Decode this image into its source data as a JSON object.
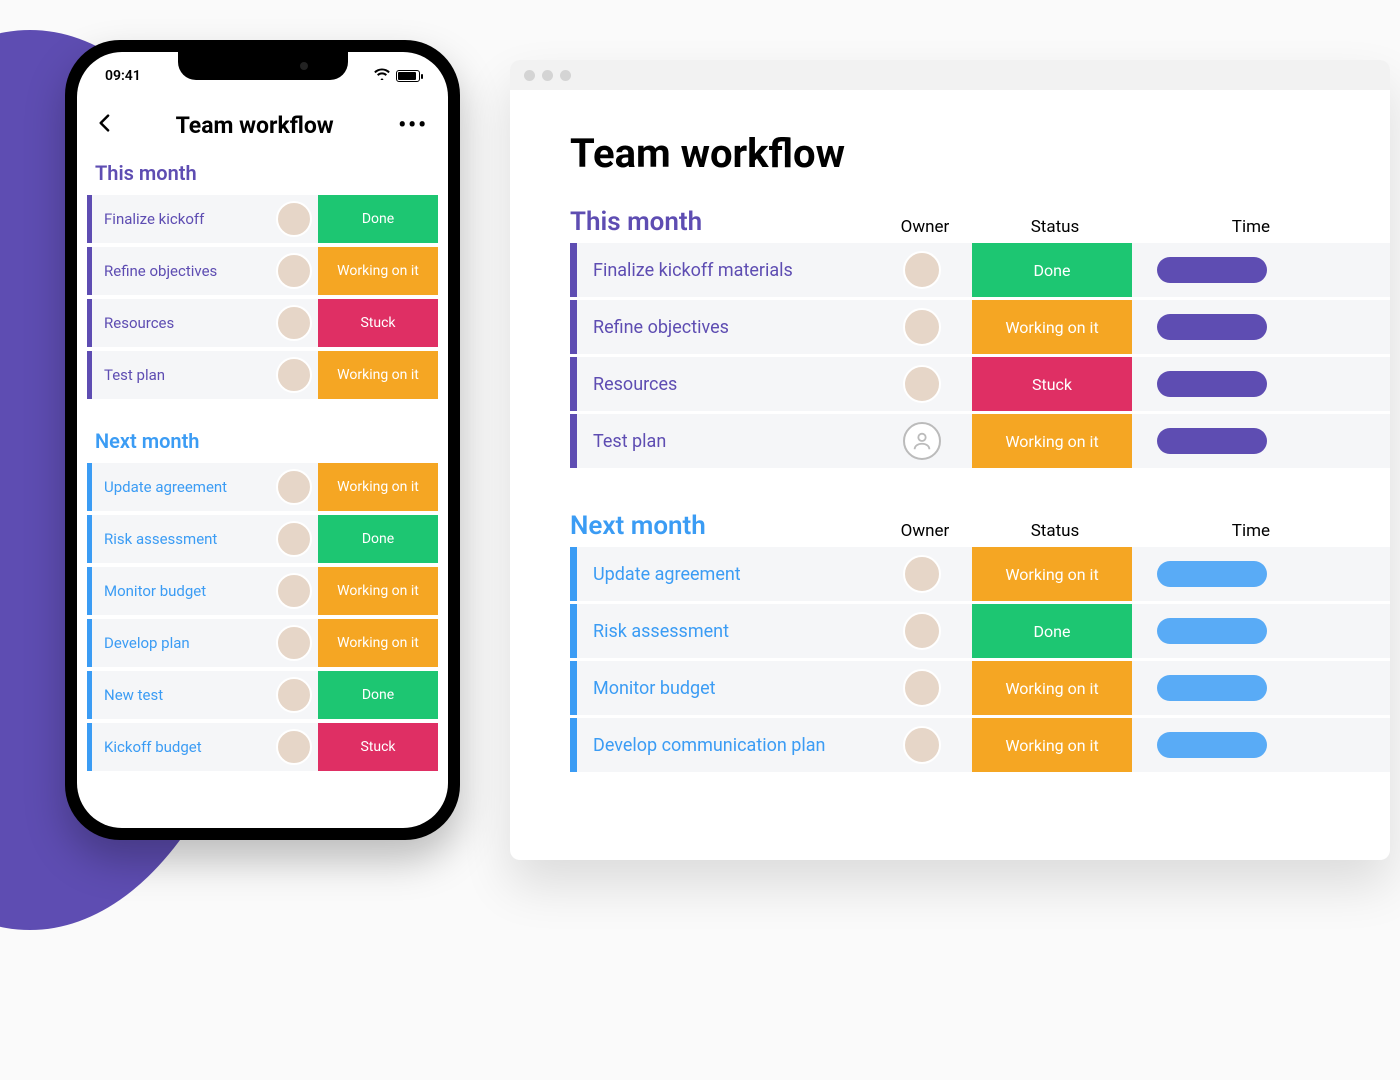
{
  "phone": {
    "clock": "09:41",
    "title": "Team workflow",
    "groups": [
      {
        "id": "this",
        "title": "This month",
        "color": "purple",
        "tasks": [
          {
            "name": "Finalize kickoff",
            "status": "Done",
            "statusClass": "st-done"
          },
          {
            "name": "Refine objectives",
            "status": "Working on it",
            "statusClass": "st-working"
          },
          {
            "name": "Resources",
            "status": "Stuck",
            "statusClass": "st-stuck"
          },
          {
            "name": "Test plan",
            "status": "Working on it",
            "statusClass": "st-working"
          }
        ]
      },
      {
        "id": "next",
        "title": "Next month",
        "color": "blue",
        "tasks": [
          {
            "name": "Update agreement",
            "status": "Working on it",
            "statusClass": "st-working"
          },
          {
            "name": "Risk assessment",
            "status": "Done",
            "statusClass": "st-done"
          },
          {
            "name": "Monitor budget",
            "status": "Working on it",
            "statusClass": "st-working"
          },
          {
            "name": "Develop plan",
            "status": "Working on it",
            "statusClass": "st-working"
          },
          {
            "name": "New test",
            "status": "Done",
            "statusClass": "st-done"
          },
          {
            "name": "Kickoff budget",
            "status": "Stuck",
            "statusClass": "st-stuck"
          }
        ]
      }
    ]
  },
  "desktop": {
    "title": "Team workflow",
    "columns": {
      "owner": "Owner",
      "status": "Status",
      "timeline": "Time"
    },
    "groups": [
      {
        "id": "this",
        "title": "This month",
        "color": "purple",
        "tasks": [
          {
            "name": "Finalize kickoff materials",
            "status": "Done",
            "statusClass": "st-done",
            "ownerPlaceholder": false
          },
          {
            "name": "Refine objectives",
            "status": "Working on it",
            "statusClass": "st-working",
            "ownerPlaceholder": false
          },
          {
            "name": "Resources",
            "status": "Stuck",
            "statusClass": "st-stuck",
            "ownerPlaceholder": false
          },
          {
            "name": "Test plan",
            "status": "Working on it",
            "statusClass": "st-working",
            "ownerPlaceholder": true
          }
        ]
      },
      {
        "id": "next",
        "title": "Next month",
        "color": "blue",
        "tasks": [
          {
            "name": "Update agreement",
            "status": "Working on it",
            "statusClass": "st-working",
            "ownerPlaceholder": false
          },
          {
            "name": "Risk assessment",
            "status": "Done",
            "statusClass": "st-done",
            "ownerPlaceholder": false
          },
          {
            "name": "Monitor budget",
            "status": "Working on it",
            "statusClass": "st-working",
            "ownerPlaceholder": false
          },
          {
            "name": "Develop communication plan",
            "status": "Working on it",
            "statusClass": "st-working",
            "ownerPlaceholder": false
          }
        ]
      }
    ]
  }
}
